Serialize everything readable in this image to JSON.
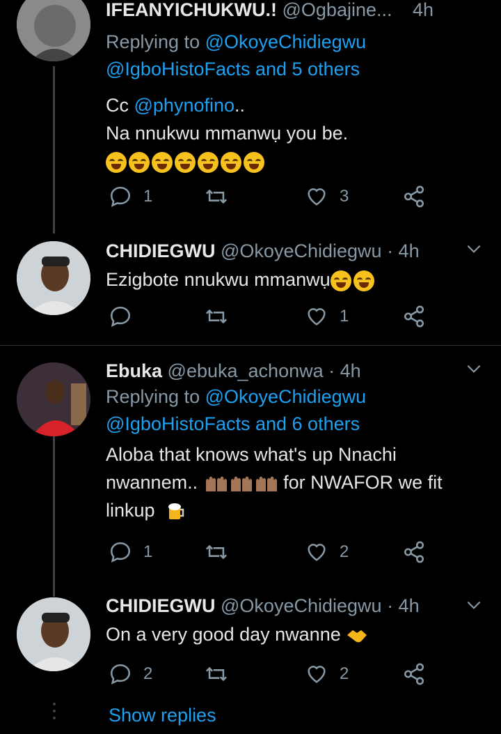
{
  "tweets": [
    {
      "name": "IFEANYICHUKWU.!",
      "handle": "@Ogbajine...",
      "time": "4h",
      "reply_prefix": "Replying to ",
      "reply_line1": "@OkoyeChidiegwu",
      "reply_line2": "@IgboHistoFacts and 5 others",
      "text_prefix": "Cc ",
      "mention": "@phynofino",
      "text_after_mention": "..",
      "text_line2": "Na nnukwu mmanwụ you be.",
      "emoji": "face-with-tears-of-joy x7",
      "replies": "1",
      "retweets": "",
      "likes": "3"
    },
    {
      "name": "CHIDIEGWU",
      "handle": "@OkoyeChidiegwu",
      "time": "· 4h",
      "text": "Ezigbote nnukwu mmanwụ",
      "emoji": "face-with-tears-of-joy x2",
      "replies": "",
      "retweets": "",
      "likes": "1"
    },
    {
      "name": "Ebuka",
      "badge": "",
      "handle": "@ebuka_achonwa",
      "time": "· 4h",
      "reply_prefix": "Replying to ",
      "reply_line1": "@OkoyeChidiegwu",
      "reply_line2": "@IgboHistoFacts and 6 others",
      "text_line1": "Aloba that knows what's up Nnachi",
      "text_line2a": "nwannem..",
      "text_line2b": " for NWAFOR  we fit",
      "text_line3": "linkup",
      "emoji": "raising-hands x3, beer-mug",
      "replies": "1",
      "retweets": "",
      "likes": "2"
    },
    {
      "name": "CHIDIEGWU",
      "handle": "@OkoyeChidiegwu",
      "time": "· 4h",
      "text": "On a very good day nwanne",
      "emoji": "handshake",
      "replies": "2",
      "retweets": "",
      "likes": "2"
    }
  ],
  "show_replies": "Show replies",
  "colors": {
    "background": "#000000",
    "link": "#1da1f2",
    "muted": "#8899a6",
    "text": "#e6e6e6"
  }
}
